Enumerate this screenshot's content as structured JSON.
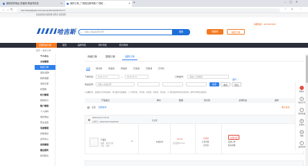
{
  "browser": {
    "tabs": [
      {
        "label": "我的收货地址-淘宝网-商品详情页"
      },
      {
        "label": "我的订单_广西哈吉斯商城-广西哈…"
      }
    ],
    "url": "test.shopdogbedit.com/personal/order/list?cur=7"
  },
  "site": {
    "welcome": "欢迎来到哈吉斯商城  请登录  免费注册",
    "logo_text": "哈吉斯",
    "search_placeholder": "请输入商品名称/货号",
    "search_button": "搜索",
    "header_buttons": [
      "购物车",
      "我的订单"
    ],
    "hotline": "客服热线：400-900-8000",
    "nav": [
      "全部商品分类",
      "首页",
      "品牌专区",
      "特价专区",
      "积分商城"
    ],
    "breadcrumb": "首页 > 我的订单"
  },
  "sidebar": {
    "items": [
      {
        "label": "个人中心",
        "type": "group"
      },
      {
        "label": "交易管理",
        "type": "group"
      },
      {
        "label": "我的订单",
        "type": "active"
      },
      {
        "label": "退货/退款",
        "type": "item"
      },
      {
        "label": "我的收藏",
        "type": "item"
      },
      {
        "label": "浏览记录",
        "type": "item"
      },
      {
        "label": "优惠券",
        "type": "item"
      },
      {
        "label": "积分管理",
        "type": "item"
      },
      {
        "label": "我的积分",
        "type": "item"
      },
      {
        "label": "账户管理",
        "type": "group"
      },
      {
        "label": "个人资料",
        "type": "item"
      },
      {
        "label": "收货地址",
        "type": "item"
      },
      {
        "label": "安全设置",
        "type": "item"
      },
      {
        "label": "消息管理",
        "type": "group"
      },
      {
        "label": "系统消息",
        "type": "item"
      },
      {
        "label": "资讯中心",
        "type": "item"
      },
      {
        "label": "发票管理",
        "type": "group"
      },
      {
        "label": "售后服务",
        "type": "group"
      },
      {
        "label": "投诉建议",
        "type": "item"
      }
    ]
  },
  "main": {
    "top_tabs": [
      "商城订单",
      "提现订单",
      "团购订单"
    ],
    "status_tabs": [
      "全部",
      "待付款",
      "待发货",
      "待收货",
      "已完成",
      "已取消",
      "已评价"
    ],
    "filters": {
      "time_label": "下单时间：",
      "date_start": "2024-07-07",
      "date_end": "2025-06-21",
      "order_label": "订单编号：",
      "order_placeholder": "请输入订单编号",
      "goods_label": "商品名称：",
      "goods_placeholder": "请输入商品名称",
      "search_btn": "搜索",
      "reset_btn": "重置",
      "export_btn": "导出",
      "more_btn": "展开"
    },
    "notice": "● 温馨提示：如果您对订单有疑问，可以联系在线客服。   ① 订单状态：待付款、待发货、待收货、已完成。   ② 请在规定时间内完成付款，超时订单将自动取消。",
    "table_headers": [
      "产品信息",
      "单价",
      "数量",
      "实付款",
      "交易状态",
      "操作"
    ],
    "select_all": "全选",
    "batch_btn": "批量操作",
    "batch_right": "确认收货",
    "order": {
      "date": "2025-06-20 17:02:15",
      "number": "订单号：2024072017434921523",
      "shop": "哈吉斯",
      "product_name": "产品名",
      "product_spec1": "规格：颜色分类",
      "product_spec2": "尺码：均码",
      "unit_price": "¥1.00",
      "qty": "x1",
      "pay_type": "在线支付",
      "total": "¥17.00",
      "total_note": "(含运费¥16.00)",
      "status_main": "待付款",
      "status_link": "订单详情",
      "status_sub": "去付款",
      "action1": "立即付款",
      "action2": "取消订单",
      "action3": "联系客服"
    }
  },
  "right_rail": [
    "购物车",
    "我的订单",
    "我的收藏",
    "优惠券",
    "客服",
    "返回顶部"
  ]
}
